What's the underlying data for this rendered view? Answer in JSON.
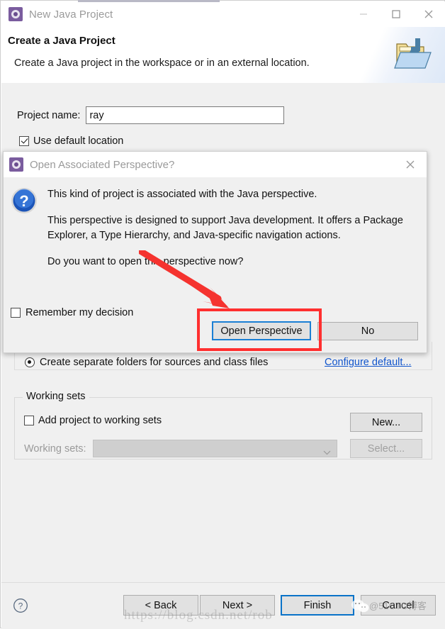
{
  "window": {
    "title": "New Java Project",
    "icon": "eclipse-gear-icon",
    "controls": {
      "minimize": "minimize-icon",
      "maximize": "maximize-icon",
      "close": "close-icon"
    }
  },
  "header": {
    "title": "Create a Java Project",
    "description": "Create a Java project in the workspace or in an external location.",
    "banner_icon": "java-project-folder-icon"
  },
  "form": {
    "project_name_label": "Project name:",
    "project_name_value": "ray",
    "project_name_placeholder": "",
    "use_default_location_label": "Use default location",
    "use_default_location_checked": true,
    "project_layout": {
      "separate_folders_label": "Create separate folders for sources and class files",
      "separate_folders_selected": true,
      "configure_default_link": "Configure default..."
    },
    "working_sets": {
      "group_label": "Working sets",
      "add_project_label": "Add project to working sets",
      "add_project_checked": false,
      "working_sets_label": "Working sets:",
      "working_sets_value": "",
      "new_button": "New...",
      "select_button": "Select...",
      "select_disabled": true
    }
  },
  "footer": {
    "help_icon": "help-icon",
    "back_button": "< Back",
    "next_button": "Next >",
    "finish_button": "Finish",
    "cancel_button": "Cancel",
    "default_button": "Finish"
  },
  "modal": {
    "title": "Open Associated Perspective?",
    "icon": "eclipse-gear-icon",
    "close_icon": "close-icon",
    "question_icon": "question-mark-icon",
    "paragraphs": [
      "This kind of project is associated with the Java perspective.",
      "This perspective is designed to support Java development. It offers a Package Explorer, a Type Hierarchy, and Java-specific navigation actions.",
      "Do you want to open this perspective now?"
    ],
    "remember_label": "Remember my decision",
    "remember_checked": false,
    "open_perspective_button": "Open Perspective",
    "no_button": "No",
    "default_button": "Open Perspective"
  },
  "annotations": {
    "highlight_color": "#ff2f2f",
    "highlight_target": "Open Perspective",
    "arrow": "red-arrow-pointing-to-open-perspective"
  },
  "watermark": {
    "url": "https://blog.csdn.net/rob",
    "brand": "@51CTO博客",
    "wechat_icon": "wechat-icon"
  },
  "colors": {
    "accent": "#0a73c8",
    "focus_border": "#1b7fd4",
    "link": "#1155cc",
    "dialog_bg": "#f0f0f0",
    "titlebar_bg": "#ffffff",
    "annotation": "#ff2f2f"
  }
}
